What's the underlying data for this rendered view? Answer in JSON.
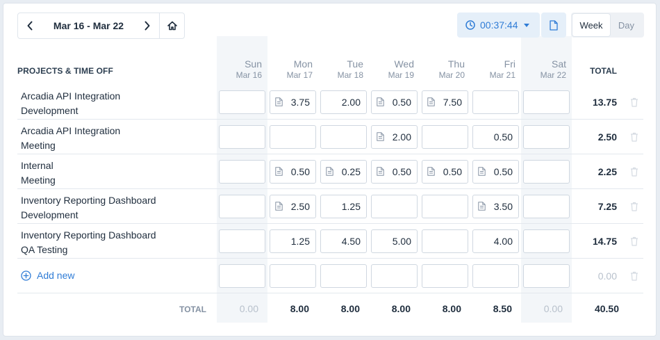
{
  "nav": {
    "date_range": "Mar 16 - Mar 22",
    "prev_icon": "chevron-left-icon",
    "next_icon": "chevron-right-icon",
    "home_icon": "home-icon"
  },
  "timer": {
    "value": "00:37:44",
    "icon": "clock-icon"
  },
  "view": {
    "week": "Week",
    "day": "Day",
    "active": "Week"
  },
  "header": {
    "projects_label": "PROJECTS & TIME OFF",
    "total_label": "TOTAL"
  },
  "days": [
    {
      "name": "Sun",
      "date": "Mar 16",
      "weekend": true
    },
    {
      "name": "Mon",
      "date": "Mar 17",
      "weekend": false
    },
    {
      "name": "Tue",
      "date": "Mar 18",
      "weekend": false
    },
    {
      "name": "Wed",
      "date": "Mar 19",
      "weekend": false
    },
    {
      "name": "Thu",
      "date": "Mar 20",
      "weekend": false
    },
    {
      "name": "Fri",
      "date": "Mar 21",
      "weekend": false
    },
    {
      "name": "Sat",
      "date": "Mar 22",
      "weekend": true
    }
  ],
  "rows": [
    {
      "project": "Arcadia API Integration",
      "task": "Development",
      "cells": [
        {
          "value": "",
          "note": false
        },
        {
          "value": "3.75",
          "note": true
        },
        {
          "value": "2.00",
          "note": false
        },
        {
          "value": "0.50",
          "note": true
        },
        {
          "value": "7.50",
          "note": true
        },
        {
          "value": "",
          "note": false
        },
        {
          "value": "",
          "note": false
        }
      ],
      "total": "13.75"
    },
    {
      "project": "Arcadia API Integration",
      "task": "Meeting",
      "cells": [
        {
          "value": "",
          "note": false
        },
        {
          "value": "",
          "note": false
        },
        {
          "value": "",
          "note": false
        },
        {
          "value": "2.00",
          "note": true
        },
        {
          "value": "",
          "note": false
        },
        {
          "value": "0.50",
          "note": false
        },
        {
          "value": "",
          "note": false
        }
      ],
      "total": "2.50"
    },
    {
      "project": "Internal",
      "task": "Meeting",
      "cells": [
        {
          "value": "",
          "note": false
        },
        {
          "value": "0.50",
          "note": true
        },
        {
          "value": "0.25",
          "note": true
        },
        {
          "value": "0.50",
          "note": true
        },
        {
          "value": "0.50",
          "note": true
        },
        {
          "value": "0.50",
          "note": true
        },
        {
          "value": "",
          "note": false
        }
      ],
      "total": "2.25"
    },
    {
      "project": "Inventory Reporting Dashboard",
      "task": "Development",
      "cells": [
        {
          "value": "",
          "note": false
        },
        {
          "value": "2.50",
          "note": true
        },
        {
          "value": "1.25",
          "note": false
        },
        {
          "value": "",
          "note": false
        },
        {
          "value": "",
          "note": false
        },
        {
          "value": "3.50",
          "note": true
        },
        {
          "value": "",
          "note": false
        }
      ],
      "total": "7.25"
    },
    {
      "project": "Inventory Reporting Dashboard",
      "task": "QA Testing",
      "cells": [
        {
          "value": "",
          "note": false
        },
        {
          "value": "1.25",
          "note": false
        },
        {
          "value": "4.50",
          "note": false
        },
        {
          "value": "5.00",
          "note": false
        },
        {
          "value": "",
          "note": false
        },
        {
          "value": "4.00",
          "note": false
        },
        {
          "value": "",
          "note": false
        }
      ],
      "total": "14.75"
    }
  ],
  "add_new": {
    "label": "Add new",
    "total": "0.00",
    "icon": "plus-circle-icon"
  },
  "totals": {
    "label": "TOTAL",
    "days": [
      "0.00",
      "8.00",
      "8.00",
      "8.00",
      "8.00",
      "8.50",
      "0.00"
    ],
    "grand": "40.50"
  },
  "colors": {
    "accent": "#2f7cd6",
    "timer_bg": "#e5eff9",
    "weekend_bg": "#f3f6f9",
    "muted": "#8592a3"
  }
}
